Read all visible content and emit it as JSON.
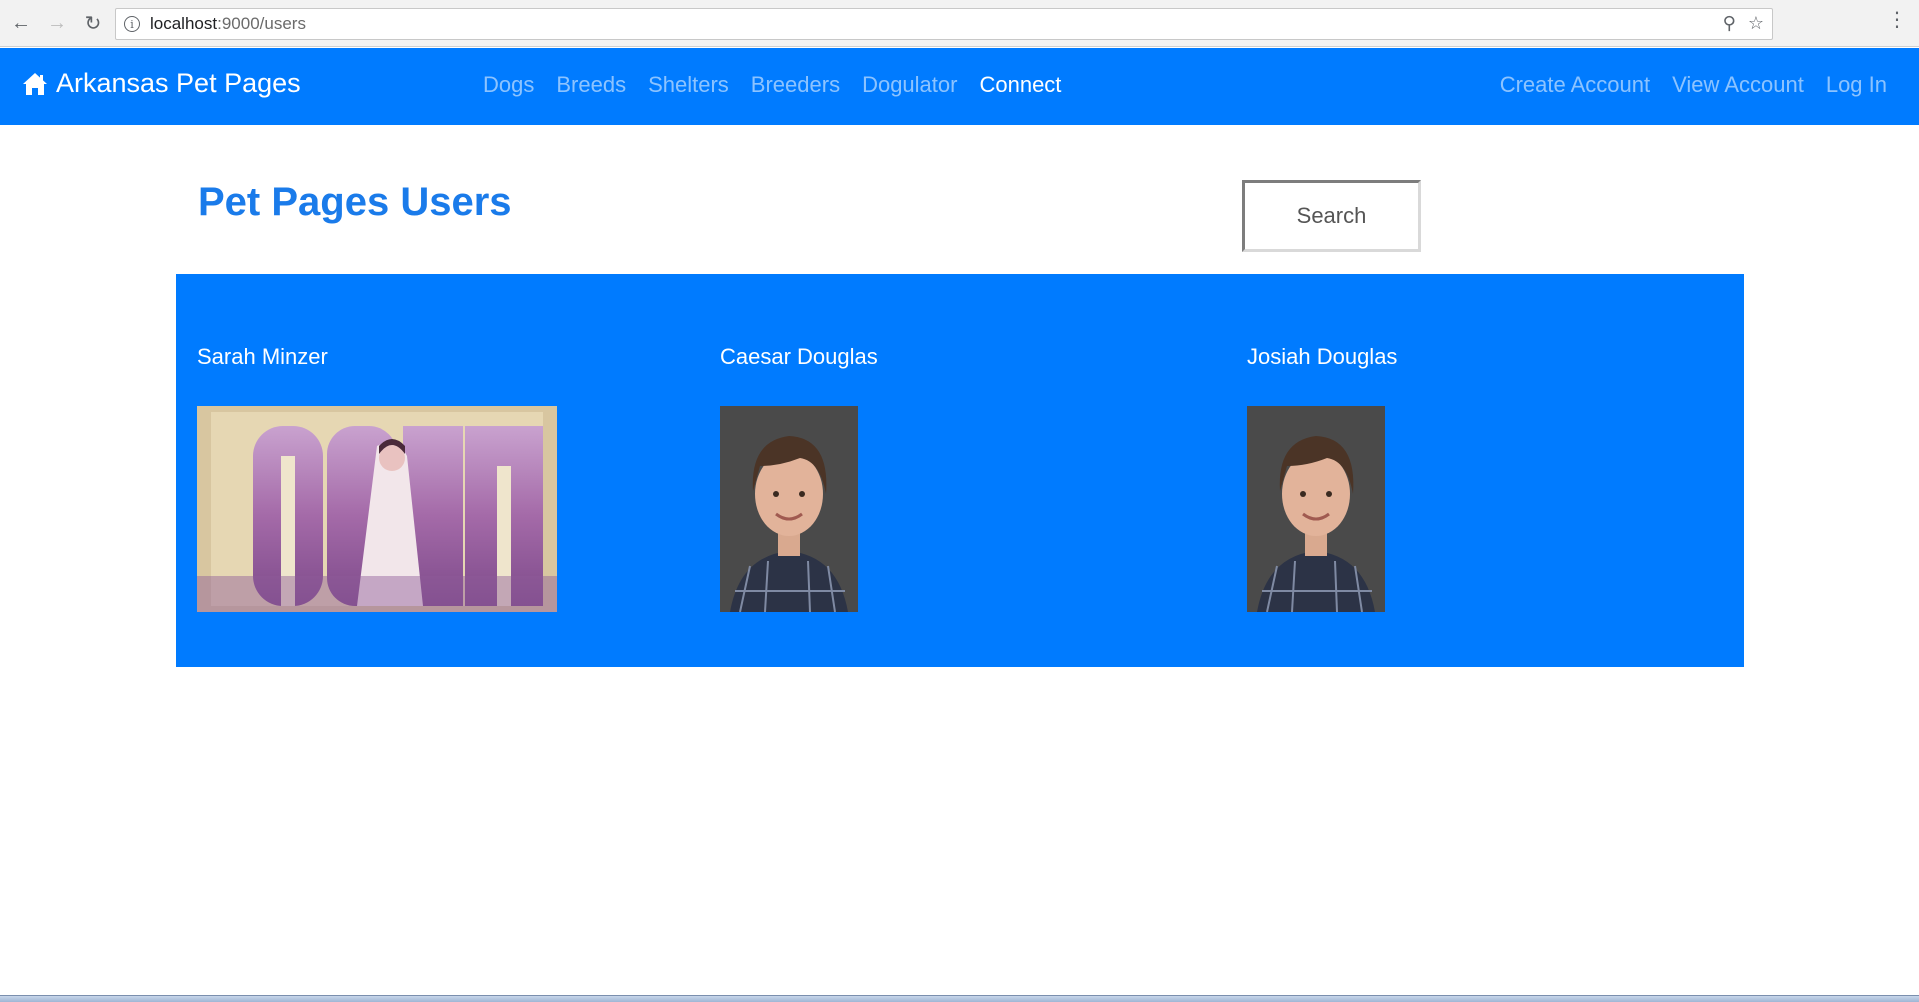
{
  "browser": {
    "url_host": "localhost",
    "url_path": ":9000/users"
  },
  "navbar": {
    "brand": "Arkansas Pet Pages",
    "center_links": [
      {
        "label": "Dogs",
        "active": false
      },
      {
        "label": "Breeds",
        "active": false
      },
      {
        "label": "Shelters",
        "active": false
      },
      {
        "label": "Breeders",
        "active": false
      },
      {
        "label": "Dogulator",
        "active": false
      },
      {
        "label": "Connect",
        "active": true
      }
    ],
    "right_links": [
      {
        "label": "Create Account"
      },
      {
        "label": "View Account"
      },
      {
        "label": "Log In"
      }
    ]
  },
  "main": {
    "title": "Pet Pages Users",
    "search_label": "Search"
  },
  "users": [
    {
      "name": "Sarah Minzer",
      "image": "movie-poster-photo"
    },
    {
      "name": "Caesar Douglas",
      "image": "portrait-photo"
    },
    {
      "name": "Josiah Douglas",
      "image": "portrait-photo"
    }
  ],
  "colors": {
    "navbar": "#007bff",
    "panel": "#007bff",
    "title": "#1a7bea"
  }
}
